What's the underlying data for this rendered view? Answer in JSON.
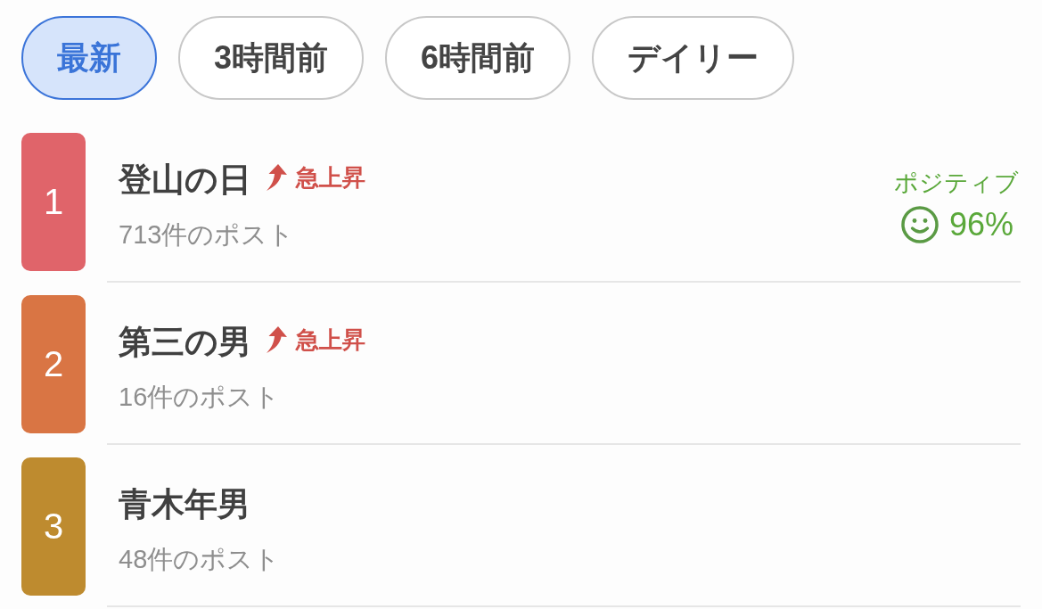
{
  "tabs": [
    {
      "label": "最新",
      "selected": true
    },
    {
      "label": "3時間前",
      "selected": false
    },
    {
      "label": "6時間前",
      "selected": false
    },
    {
      "label": "デイリー",
      "selected": false
    }
  ],
  "trends": [
    {
      "rank": "1",
      "color": "#e0646a",
      "title": "登山の日",
      "rising_label": "急上昇",
      "posts": "713件のポスト",
      "sentiment": {
        "label": "ポジティブ",
        "reading": "96%"
      }
    },
    {
      "rank": "2",
      "color": "#d97544",
      "title": "第三の男",
      "rising_label": "急上昇",
      "posts": "16件のポスト"
    },
    {
      "rank": "3",
      "color": "#be8b2f",
      "title": "青木年男",
      "posts": "48件のポスト"
    }
  ]
}
